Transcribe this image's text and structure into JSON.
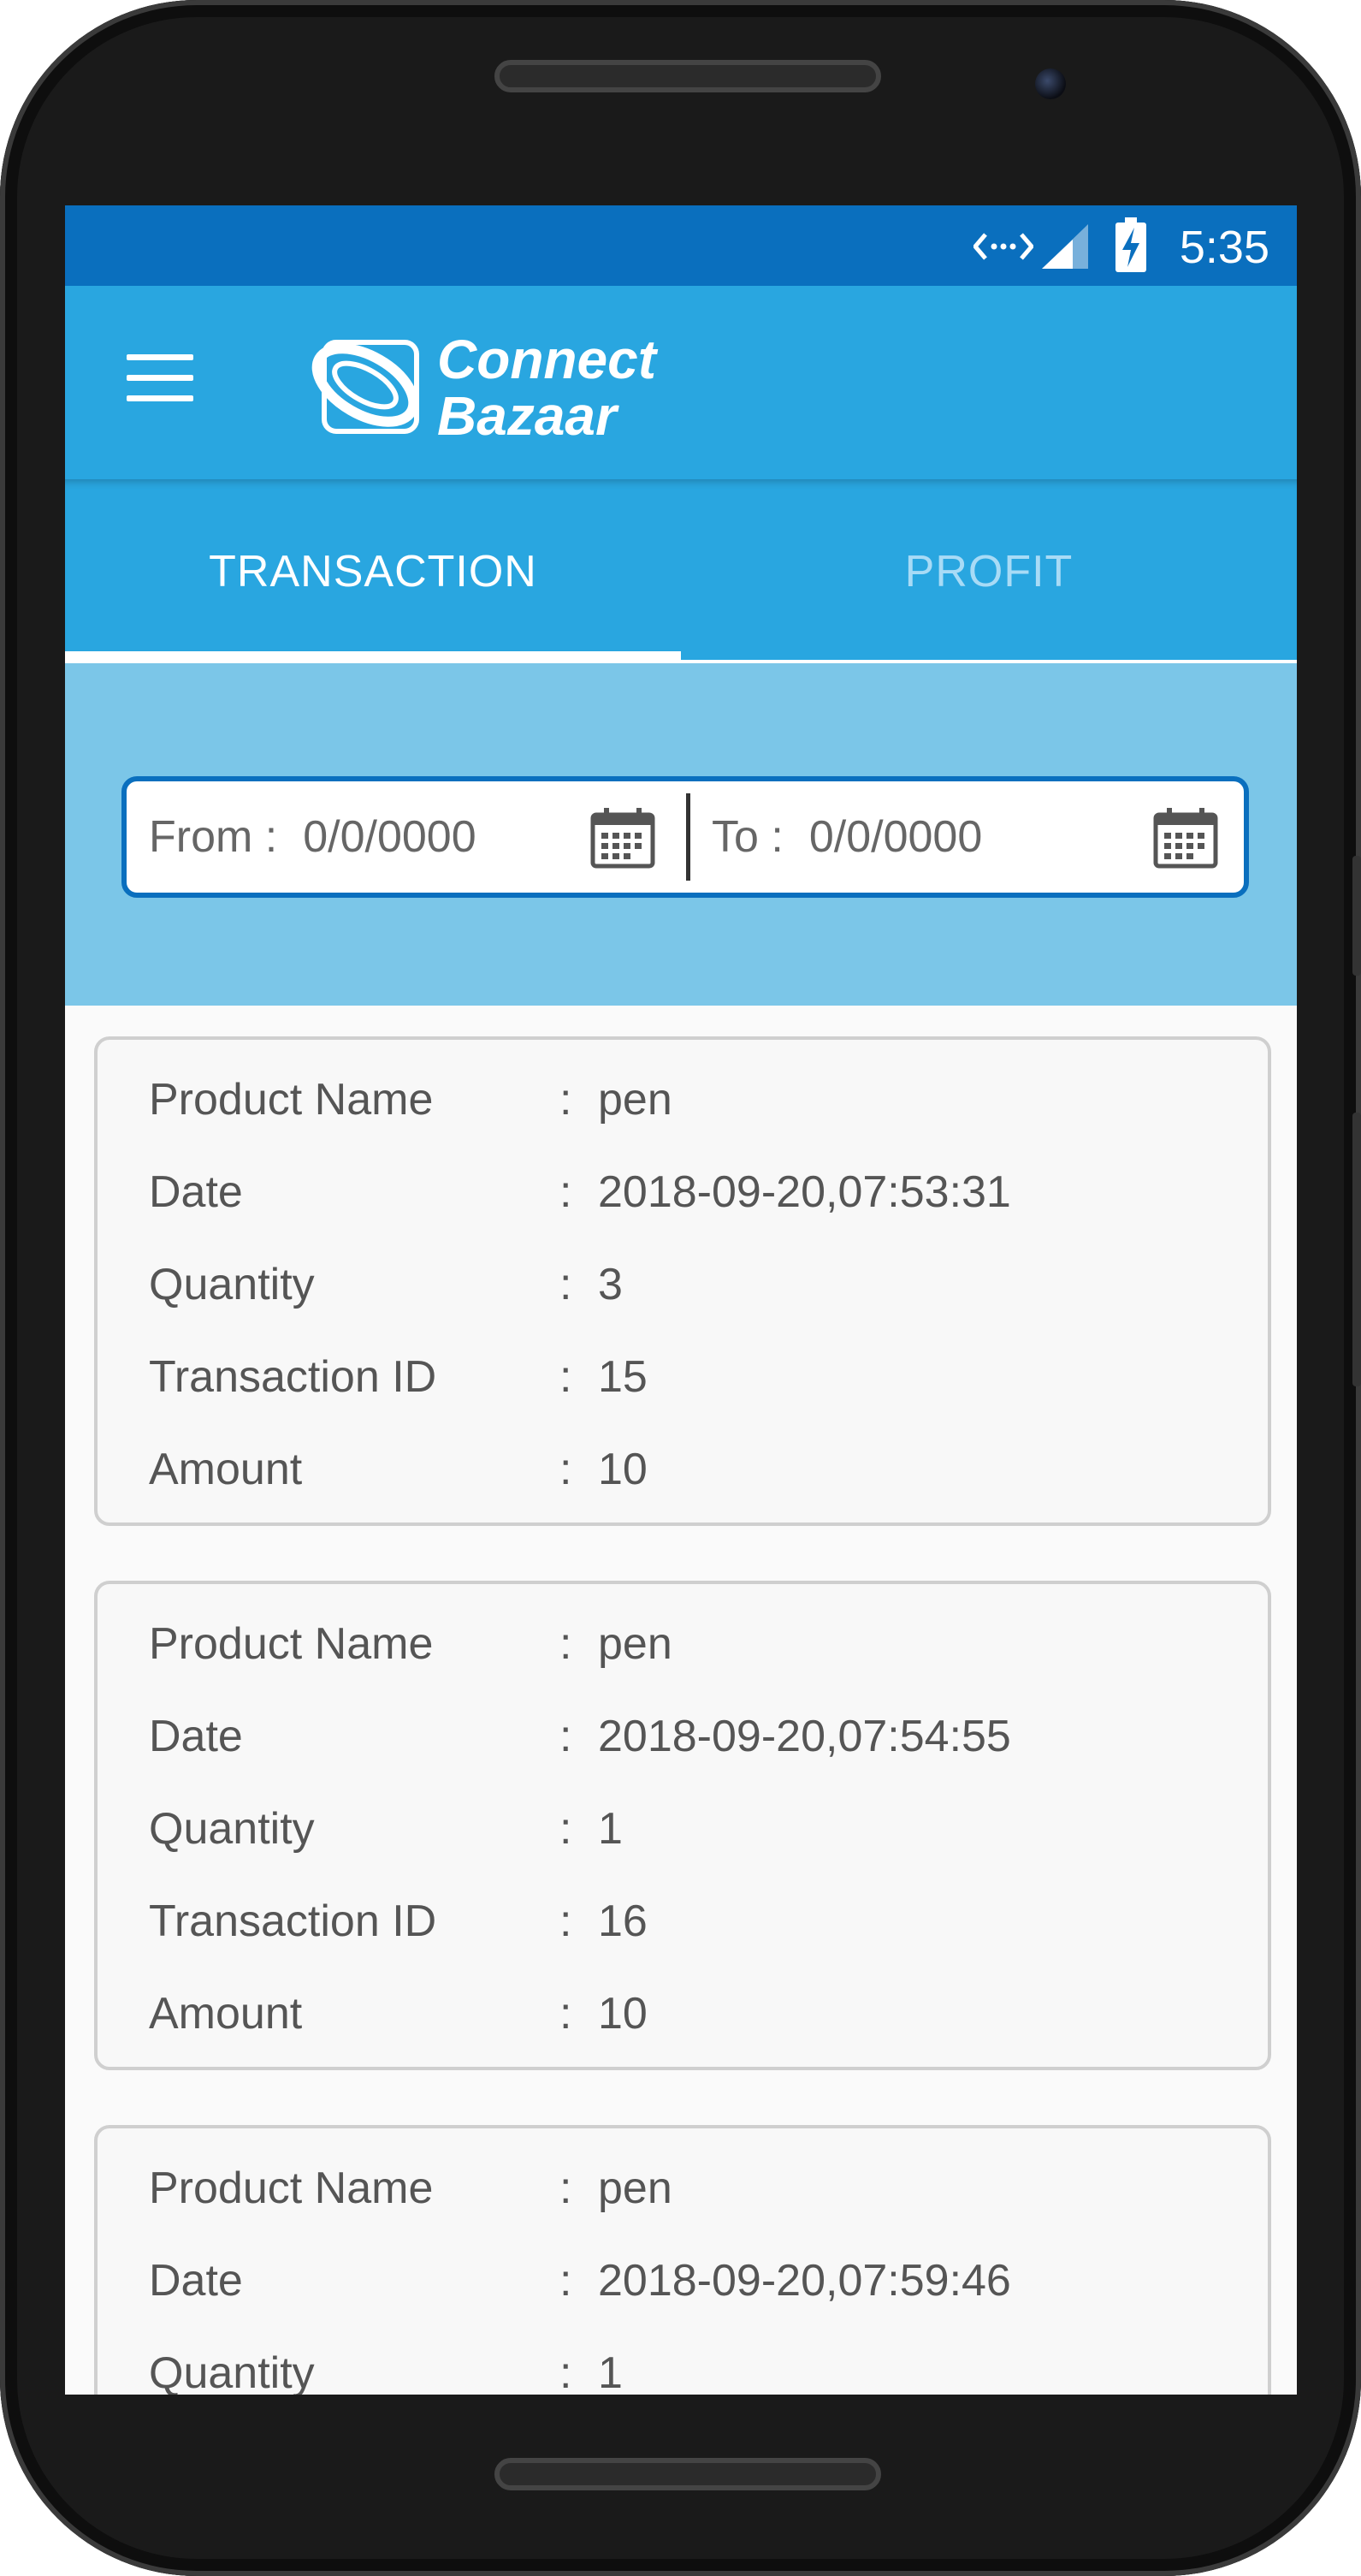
{
  "status_bar": {
    "time": "5:35",
    "icons": [
      "data-transfer-icon",
      "signal-icon",
      "battery-charging-icon"
    ]
  },
  "app_bar": {
    "logo_line1": "Connect",
    "logo_line2": "Bazaar"
  },
  "tabs": [
    {
      "label": "TRANSACTION",
      "active": true
    },
    {
      "label": "PROFIT",
      "active": false
    }
  ],
  "filter": {
    "from_label": "From :",
    "from_value": "0/0/0000",
    "to_label": "To :",
    "to_value": "0/0/0000"
  },
  "labels": {
    "product_name": "Product Name",
    "date": "Date",
    "quantity": "Quantity",
    "transaction_id": "Transaction ID",
    "amount": "Amount",
    "separator": ":"
  },
  "transactions": [
    {
      "product_name": "pen",
      "date": "2018-09-20,07:53:31",
      "quantity": "3",
      "transaction_id": "15",
      "amount": "10"
    },
    {
      "product_name": "pen",
      "date": "2018-09-20,07:54:55",
      "quantity": "1",
      "transaction_id": "16",
      "amount": "10"
    },
    {
      "product_name": "pen",
      "date": "2018-09-20,07:59:46",
      "quantity": "1"
    }
  ],
  "colors": {
    "status_bar": "#0a6fbe",
    "app_bar": "#29a6e0",
    "filter_background": "#7bc6e8",
    "accent_border": "#0a6fbe"
  }
}
